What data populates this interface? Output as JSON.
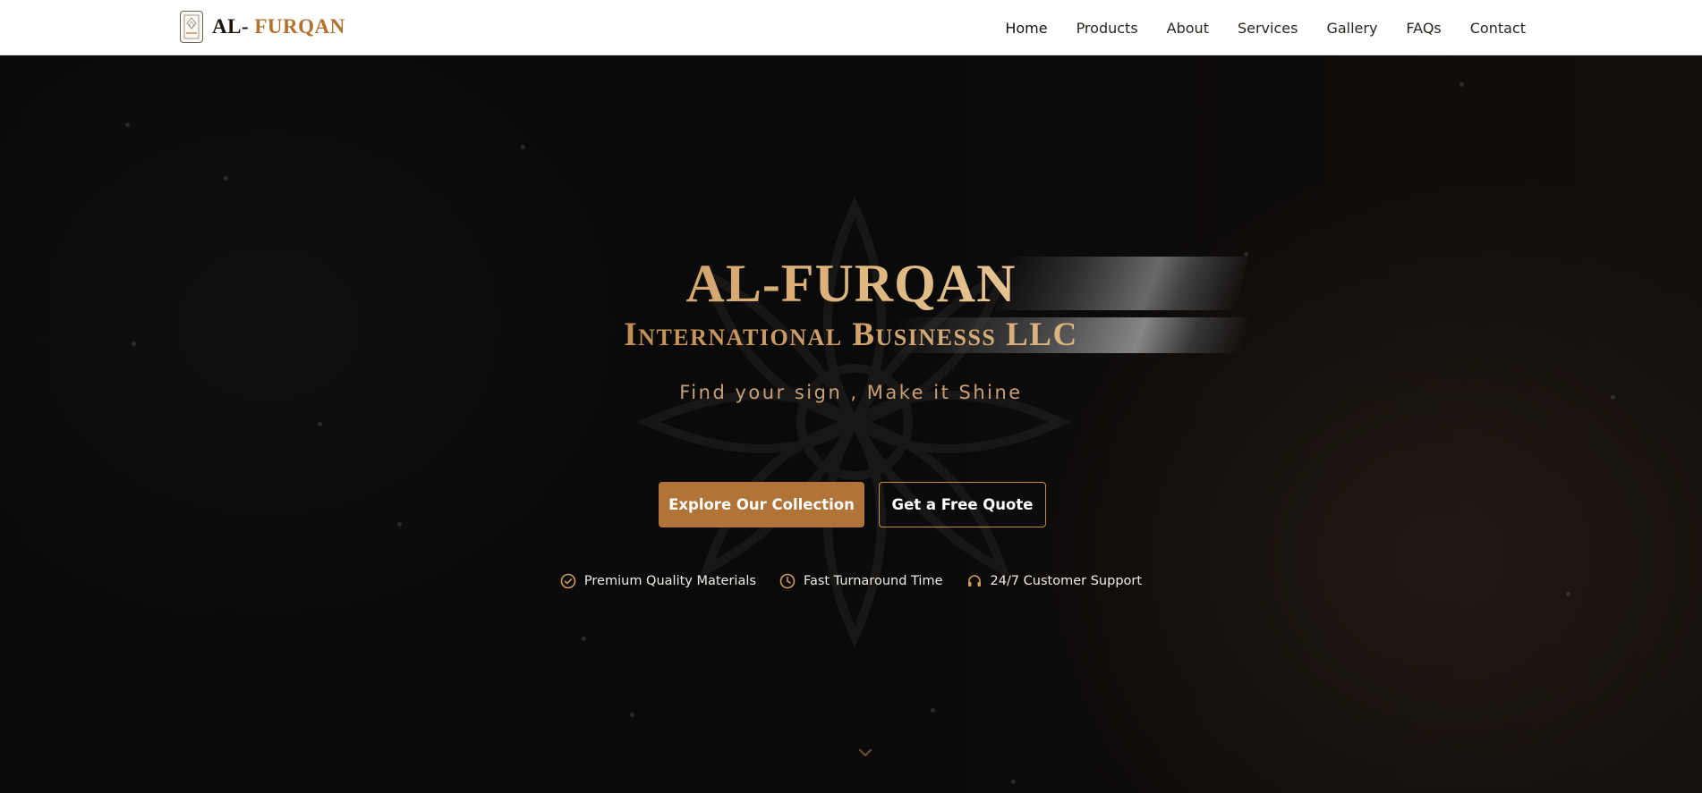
{
  "brand": {
    "name_prefix": "AL-",
    "name_suffix": "FURQAN",
    "accent_color": "#b17438",
    "logo_icon": "ornate-frame-logo-icon"
  },
  "nav": {
    "items": [
      {
        "label": "Home",
        "active": true
      },
      {
        "label": "Products",
        "active": false
      },
      {
        "label": "About",
        "active": false
      },
      {
        "label": "Services",
        "active": false
      },
      {
        "label": "Gallery",
        "active": false
      },
      {
        "label": "FAQs",
        "active": false
      },
      {
        "label": "Contact",
        "active": false
      }
    ]
  },
  "hero": {
    "title": "AL-FURQAN",
    "subtitle": "International Businesss LLC",
    "tagline": "Find your sign , Make it Shine",
    "primary_button": "Explore Our Collection",
    "secondary_button": "Get a Free Quote",
    "features": [
      {
        "icon": "check-circle-icon",
        "label": "Premium Quality Materials"
      },
      {
        "icon": "clock-icon",
        "label": "Fast Turnaround Time"
      },
      {
        "icon": "headset-icon",
        "label": "24/7 Customer Support"
      }
    ],
    "scroll_icon": "chevron-down-icon"
  },
  "colors": {
    "navbar_bg": "#ffffff",
    "hero_bg": "#0b0a09",
    "gold": "#c99a5e",
    "button_primary": "#b17438"
  }
}
